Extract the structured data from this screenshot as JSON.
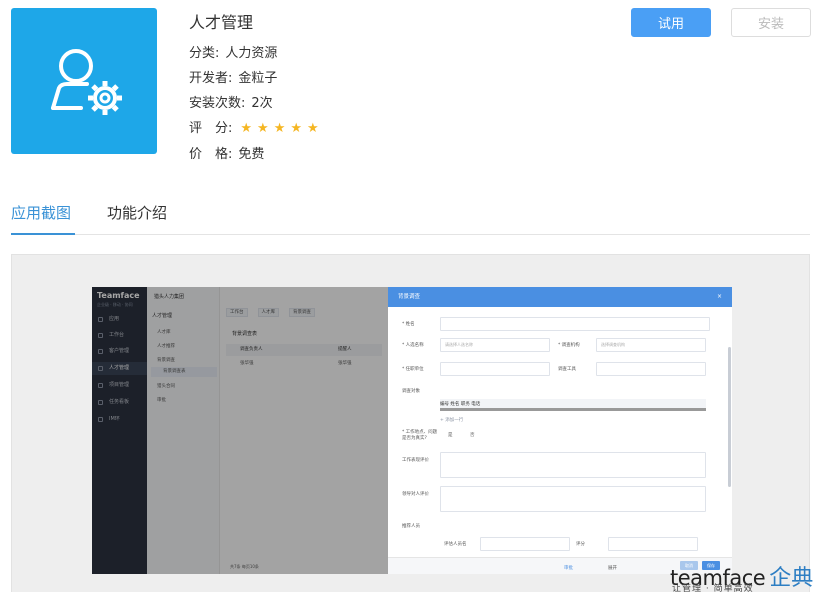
{
  "app": {
    "name": "人才管理",
    "icon": "user-gear-icon",
    "icon_color": "#1ea7e8",
    "category_label": "分类:",
    "category": "人力资源",
    "developer_label": "开发者:",
    "developer": "金粒子",
    "installs_label": "安装次数:",
    "installs": "2次",
    "rating_label": "评　分:",
    "rating_stars": "★★★★★",
    "rating_value": 5,
    "price_label": "价　格:",
    "price": "免费"
  },
  "actions": {
    "try_label": "试用",
    "install_label": "安装",
    "accent_color": "#4a9ff5"
  },
  "tabs": [
    {
      "label": "应用截图",
      "active": true
    },
    {
      "label": "功能介绍",
      "active": false
    }
  ],
  "screenshot": {
    "logo": "Teamface",
    "logo_sub": "企业级 · 移动 · 协同",
    "nav": [
      "应用",
      "工作台",
      "客户管理",
      "人才管理",
      "项目管理",
      "任务看板",
      "IM环"
    ],
    "sub_head": "猎头人力集团",
    "sub_section": "人才管理",
    "sub_items": [
      "人才库",
      "人才推荐",
      "背景调查",
      "背景调查表",
      "猎头合同",
      "审批"
    ],
    "tabs": [
      "工作台",
      "人才库",
      "背景调查"
    ],
    "list_title": "背景调查表",
    "col_1": "调查负责人",
    "col_2": "提醒人",
    "row_1": "张华强",
    "row_2": "张华强",
    "footer": "共7条   每页10条",
    "modal_title": "背景调查",
    "modal_close": "×",
    "fields": {
      "name": "* 姓名",
      "candidate": "* 人选名称",
      "candidate_ph": "请选择人选名称",
      "agency": "* 调查机构",
      "agency_ph": "选择调查机构",
      "company": "* 任职单位",
      "channel": "调查工具",
      "records": "调查对象",
      "sub_cols": "编号        姓名                                        职务                                      电话",
      "add_row": "+ 添加一行",
      "willing": "* 工作地点、问题是否为真实?",
      "yes": "是",
      "no": "否",
      "work_eval": "工作表现评价",
      "leader_eval": "领导对人评价",
      "ref": "推荐人员",
      "ref_name": "评估人员名",
      "ref_score": "评分"
    },
    "modal_buttons": [
      "取消",
      "保存"
    ],
    "footer_select": "审批",
    "footer_select_right": "展开"
  },
  "watermark": {
    "main": "teamface",
    "cn": "企典",
    "sub": "让管理 · 简单高效"
  }
}
